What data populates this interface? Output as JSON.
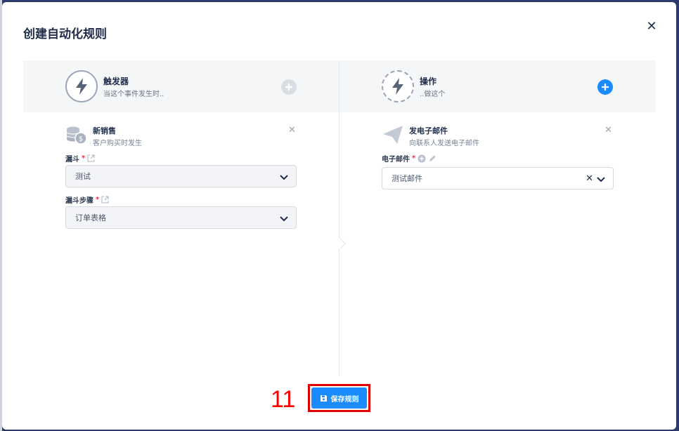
{
  "modal": {
    "title": "创建自动化规则",
    "close_icon": "close-icon"
  },
  "trigger": {
    "title": "触发器",
    "subtitle": "当这个事件发生时..",
    "icon": "lightning-icon",
    "add_icon": "plus-circle-icon"
  },
  "action": {
    "title": "操作",
    "subtitle": "..做这个",
    "icon": "lightning-icon",
    "add_icon": "plus-circle-icon"
  },
  "trigger_card": {
    "title": "新销售",
    "subtitle": "客户购买时发生",
    "icon": "coins-dollar-icon",
    "fields": [
      {
        "label": "漏斗",
        "required": "*",
        "value": "测试"
      },
      {
        "label": "漏斗步骤",
        "required": "*",
        "value": "订单表格"
      }
    ]
  },
  "action_card": {
    "title": "发电子邮件",
    "subtitle": "向联系人发送电子邮件",
    "icon": "paper-plane-icon",
    "fields": [
      {
        "label": "电子邮件",
        "required": "*",
        "value": "测试邮件"
      }
    ]
  },
  "footer": {
    "save_label": "保存规则",
    "save_icon": "floppy-disk-icon",
    "step_number": "11"
  },
  "colors": {
    "accent": "#1a8cff",
    "required": "#e5364a",
    "highlight": "#e00000"
  }
}
